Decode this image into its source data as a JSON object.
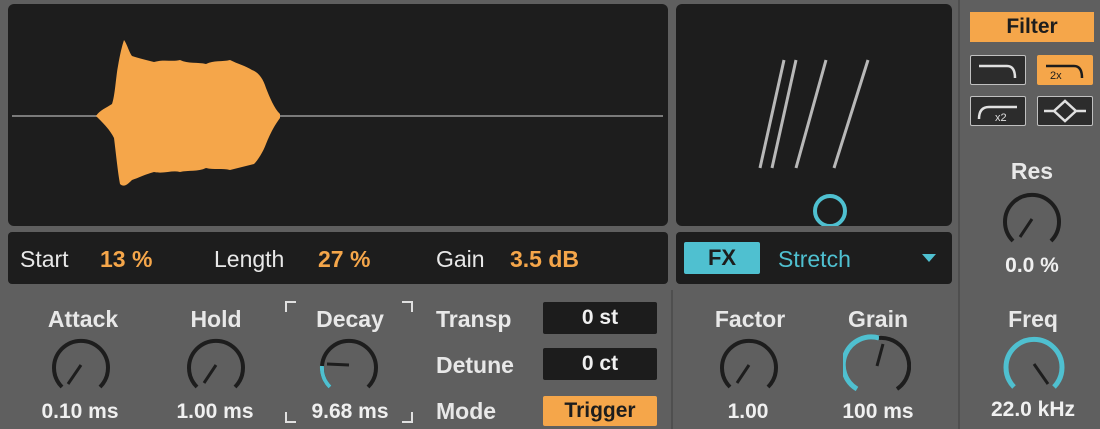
{
  "sample": {
    "start_label": "Start",
    "start_value": "13 %",
    "length_label": "Length",
    "length_value": "27 %",
    "gain_label": "Gain",
    "gain_value": "3.5 dB"
  },
  "fx": {
    "button_label": "FX",
    "mode_value": "Stretch"
  },
  "filter": {
    "button_label": "Filter",
    "res_label": "Res",
    "res_value": "0.0 %",
    "freq_label": "Freq",
    "freq_value": "22.0 kHz",
    "badge_2x": "2x",
    "badge_x2": "x2"
  },
  "envelope": {
    "attack_label": "Attack",
    "attack_value": "0.10 ms",
    "hold_label": "Hold",
    "hold_value": "1.00 ms",
    "decay_label": "Decay",
    "decay_value": "9.68 ms"
  },
  "pitch": {
    "transp_label": "Transp",
    "transp_value": "0 st",
    "detune_label": "Detune",
    "detune_value": "0 ct",
    "mode_label": "Mode",
    "mode_value": "Trigger"
  },
  "stretch": {
    "factor_label": "Factor",
    "factor_value": "1.00",
    "grain_label": "Grain",
    "grain_value": "100 ms"
  },
  "colors": {
    "accent_orange": "#f5a64a",
    "accent_cyan": "#4fc0d0",
    "panel_dark": "#1d1d1d"
  }
}
